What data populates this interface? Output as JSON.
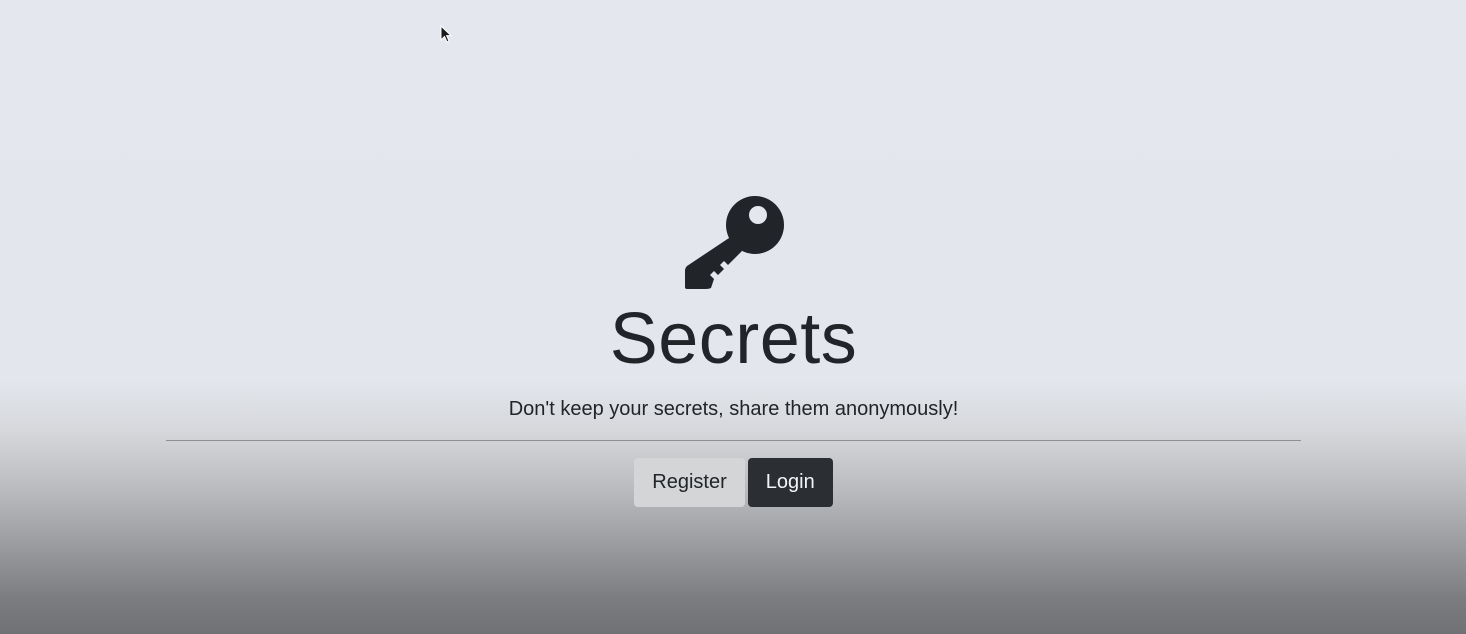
{
  "hero": {
    "icon": "key-icon",
    "title": "Secrets",
    "tagline": "Don't keep your secrets, share them anonymously!"
  },
  "actions": {
    "register_label": "Register",
    "login_label": "Login"
  },
  "colors": {
    "text": "#212529",
    "register_button_bg": "#d4d5d7",
    "login_button_bg": "#2b2f34",
    "login_button_text": "#f3f4f6"
  }
}
